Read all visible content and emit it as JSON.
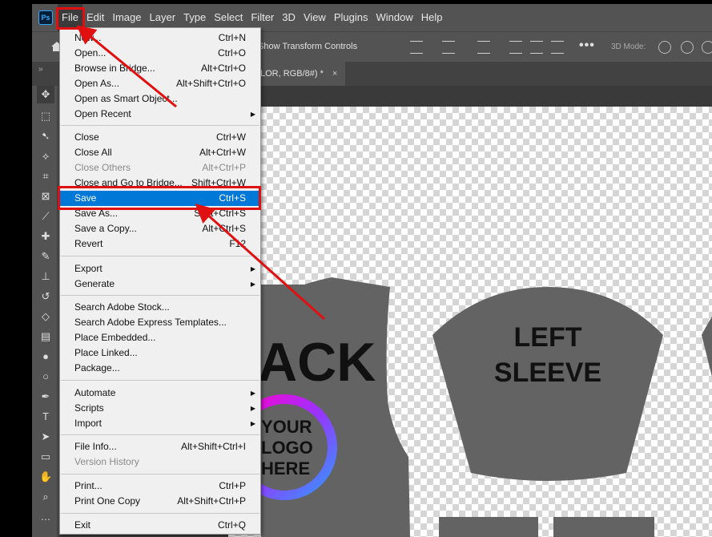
{
  "app": {
    "logo": "Ps"
  },
  "menubar": {
    "items": [
      "File",
      "Edit",
      "Image",
      "Layer",
      "Type",
      "Select",
      "Filter",
      "3D",
      "View",
      "Plugins",
      "Window",
      "Help"
    ]
  },
  "options": {
    "show_transform": "Show Transform Controls",
    "mode3d": "3D Mode:",
    "more": "•••"
  },
  "document_tab": {
    "title": "LOR, RGB/8#) *",
    "close": "×"
  },
  "file_menu": {
    "items": [
      {
        "label": "New...",
        "shortcut": "Ctrl+N"
      },
      {
        "label": "Open...",
        "shortcut": "Ctrl+O"
      },
      {
        "label": "Browse in Bridge...",
        "shortcut": "Alt+Ctrl+O"
      },
      {
        "label": "Open As...",
        "shortcut": "Alt+Shift+Ctrl+O"
      },
      {
        "label": "Open as Smart Object...",
        "shortcut": ""
      },
      {
        "label": "Open Recent",
        "shortcut": ""
      },
      {
        "label": "Close",
        "shortcut": "Ctrl+W"
      },
      {
        "label": "Close All",
        "shortcut": "Alt+Ctrl+W"
      },
      {
        "label": "Close Others",
        "shortcut": "Alt+Ctrl+P"
      },
      {
        "label": "Close and Go to Bridge...",
        "shortcut": "Shift+Ctrl+W"
      },
      {
        "label": "Save",
        "shortcut": "Ctrl+S"
      },
      {
        "label": "Save As...",
        "shortcut": "Shift+Ctrl+S"
      },
      {
        "label": "Save a Copy...",
        "shortcut": "Alt+Ctrl+S"
      },
      {
        "label": "Revert",
        "shortcut": "F12"
      },
      {
        "label": "Export",
        "shortcut": ""
      },
      {
        "label": "Generate",
        "shortcut": ""
      },
      {
        "label": "Search Adobe Stock...",
        "shortcut": ""
      },
      {
        "label": "Search Adobe Express Templates...",
        "shortcut": ""
      },
      {
        "label": "Place Embedded...",
        "shortcut": ""
      },
      {
        "label": "Place Linked...",
        "shortcut": ""
      },
      {
        "label": "Package...",
        "shortcut": ""
      },
      {
        "label": "Automate",
        "shortcut": ""
      },
      {
        "label": "Scripts",
        "shortcut": ""
      },
      {
        "label": "Import",
        "shortcut": ""
      },
      {
        "label": "File Info...",
        "shortcut": "Alt+Shift+Ctrl+I"
      },
      {
        "label": "Version History",
        "shortcut": ""
      },
      {
        "label": "Print...",
        "shortcut": "Ctrl+P"
      },
      {
        "label": "Print One Copy",
        "shortcut": "Alt+Shift+Ctrl+P"
      },
      {
        "label": "Exit",
        "shortcut": "Ctrl+Q"
      }
    ]
  },
  "artwork": {
    "back_text": "ACK",
    "logo_lines": [
      "YOUR",
      "LOGO",
      "HERE"
    ],
    "sleeve_lines": [
      "LEFT",
      "SLEEVE"
    ]
  },
  "colors": {
    "highlight": "#0078d7",
    "annotation": "#e01010",
    "garment": "#636363"
  }
}
